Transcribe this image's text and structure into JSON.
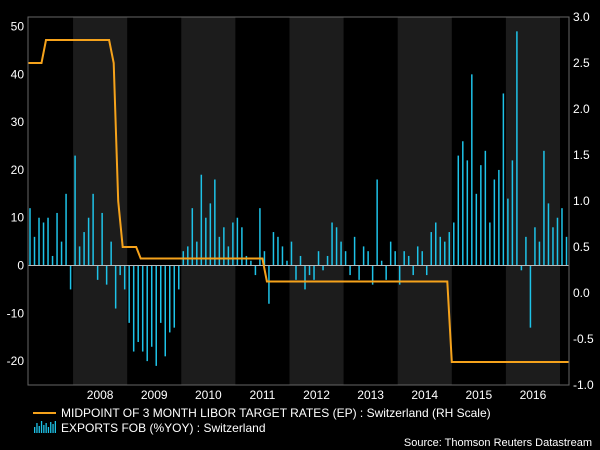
{
  "chart_data": {
    "type": "bar+line",
    "x_range": [
      "2007-03",
      "2017-03"
    ],
    "year_labels": [
      "2008",
      "2009",
      "2010",
      "2011",
      "2012",
      "2013",
      "2014",
      "2015",
      "2016"
    ],
    "left_axis": {
      "ylim": [
        -25,
        52
      ],
      "ticks": [
        "50",
        "40",
        "30",
        "20",
        "10",
        "0",
        "-10",
        "-20"
      ],
      "tick_values": [
        50,
        40,
        30,
        20,
        10,
        0,
        -10,
        -20
      ]
    },
    "right_axis": {
      "ylim": [
        -1.0,
        3.0
      ],
      "ticks": [
        "3.0",
        "2.5",
        "2.0",
        "1.5",
        "1.0",
        "0.5",
        "0.0",
        "-0.5",
        "-1.0"
      ],
      "tick_values": [
        3.0,
        2.5,
        2.0,
        1.5,
        1.0,
        0.5,
        0.0,
        -0.5,
        -1.0
      ]
    },
    "shaded_years": [
      "2008",
      "2010",
      "2012",
      "2014",
      "2016"
    ],
    "grid": false,
    "series": [
      {
        "name": "MIDPOINT OF 3 MONTH LIBOR TARGET RATES (EP) : Switzerland (RH Scale)",
        "kind": "line",
        "axis": "right",
        "color": "#f5a21b",
        "points": [
          [
            "2007-03",
            2.5
          ],
          [
            "2007-06",
            2.5
          ],
          [
            "2007-07",
            2.75
          ],
          [
            "2008-09",
            2.75
          ],
          [
            "2008-10",
            2.5
          ],
          [
            "2008-11",
            1.0
          ],
          [
            "2008-12",
            0.5
          ],
          [
            "2009-03",
            0.5
          ],
          [
            "2009-04",
            0.375
          ],
          [
            "2011-07",
            0.375
          ],
          [
            "2011-08",
            0.125
          ],
          [
            "2014-12",
            0.125
          ],
          [
            "2015-01",
            -0.75
          ],
          [
            "2017-03",
            -0.75
          ]
        ]
      },
      {
        "name": "EXPORTS FOB (%YOY) : Switzerland",
        "kind": "bar",
        "axis": "left",
        "color": "#1ec3e8",
        "points": [
          [
            "2007-03",
            12
          ],
          [
            "2007-04",
            6
          ],
          [
            "2007-05",
            10
          ],
          [
            "2007-06",
            9
          ],
          [
            "2007-07",
            10
          ],
          [
            "2007-08",
            2
          ],
          [
            "2007-09",
            11
          ],
          [
            "2007-10",
            5
          ],
          [
            "2007-11",
            15
          ],
          [
            "2007-12",
            -5
          ],
          [
            "2008-01",
            23
          ],
          [
            "2008-02",
            4
          ],
          [
            "2008-03",
            7
          ],
          [
            "2008-04",
            10
          ],
          [
            "2008-05",
            15
          ],
          [
            "2008-06",
            -3
          ],
          [
            "2008-07",
            11
          ],
          [
            "2008-08",
            -4
          ],
          [
            "2008-09",
            5
          ],
          [
            "2008-10",
            -9
          ],
          [
            "2008-11",
            -2
          ],
          [
            "2008-12",
            -5
          ],
          [
            "2009-01",
            -12
          ],
          [
            "2009-02",
            -18
          ],
          [
            "2009-03",
            -16
          ],
          [
            "2009-04",
            -18
          ],
          [
            "2009-05",
            -20
          ],
          [
            "2009-06",
            -17
          ],
          [
            "2009-07",
            -21
          ],
          [
            "2009-08",
            -12
          ],
          [
            "2009-09",
            -19
          ],
          [
            "2009-10",
            -14
          ],
          [
            "2009-11",
            -13
          ],
          [
            "2009-12",
            -5
          ],
          [
            "2010-01",
            3
          ],
          [
            "2010-02",
            4
          ],
          [
            "2010-03",
            12
          ],
          [
            "2010-04",
            5
          ],
          [
            "2010-05",
            19
          ],
          [
            "2010-06",
            10
          ],
          [
            "2010-07",
            13
          ],
          [
            "2010-08",
            18
          ],
          [
            "2010-09",
            6
          ],
          [
            "2010-10",
            8
          ],
          [
            "2010-11",
            4
          ],
          [
            "2010-12",
            9
          ],
          [
            "2011-01",
            10
          ],
          [
            "2011-02",
            8
          ],
          [
            "2011-03",
            2
          ],
          [
            "2011-04",
            1
          ],
          [
            "2011-05",
            -2
          ],
          [
            "2011-06",
            12
          ],
          [
            "2011-07",
            3
          ],
          [
            "2011-08",
            -8
          ],
          [
            "2011-09",
            7
          ],
          [
            "2011-10",
            6
          ],
          [
            "2011-11",
            4
          ],
          [
            "2011-12",
            1
          ],
          [
            "2012-01",
            5
          ],
          [
            "2012-02",
            -3
          ],
          [
            "2012-03",
            2
          ],
          [
            "2012-04",
            -5
          ],
          [
            "2012-05",
            -2
          ],
          [
            "2012-06",
            -3
          ],
          [
            "2012-07",
            3
          ],
          [
            "2012-08",
            -1
          ],
          [
            "2012-09",
            2
          ],
          [
            "2012-10",
            9
          ],
          [
            "2012-11",
            8
          ],
          [
            "2012-12",
            5
          ],
          [
            "2013-01",
            3
          ],
          [
            "2013-02",
            -2
          ],
          [
            "2013-03",
            6
          ],
          [
            "2013-04",
            -3
          ],
          [
            "2013-05",
            4
          ],
          [
            "2013-06",
            3
          ],
          [
            "2013-07",
            -4
          ],
          [
            "2013-08",
            18
          ],
          [
            "2013-09",
            1
          ],
          [
            "2013-10",
            -3
          ],
          [
            "2013-11",
            5
          ],
          [
            "2013-12",
            3
          ],
          [
            "2014-01",
            -4
          ],
          [
            "2014-02",
            3
          ],
          [
            "2014-03",
            2
          ],
          [
            "2014-04",
            -2
          ],
          [
            "2014-05",
            4
          ],
          [
            "2014-06",
            3
          ],
          [
            "2014-07",
            -2
          ],
          [
            "2014-08",
            7
          ],
          [
            "2014-09",
            9
          ],
          [
            "2014-10",
            6
          ],
          [
            "2014-11",
            5
          ],
          [
            "2014-12",
            7
          ],
          [
            "2015-01",
            9
          ],
          [
            "2015-02",
            23
          ],
          [
            "2015-03",
            26
          ],
          [
            "2015-04",
            22
          ],
          [
            "2015-05",
            40
          ],
          [
            "2015-06",
            15
          ],
          [
            "2015-07",
            21
          ],
          [
            "2015-08",
            24
          ],
          [
            "2015-09",
            9
          ],
          [
            "2015-10",
            18
          ],
          [
            "2015-11",
            20
          ],
          [
            "2015-12",
            36
          ],
          [
            "2016-01",
            14
          ],
          [
            "2016-02",
            22
          ],
          [
            "2016-03",
            49
          ],
          [
            "2016-04",
            -1
          ],
          [
            "2016-05",
            6
          ],
          [
            "2016-06",
            -13
          ],
          [
            "2016-07",
            8
          ],
          [
            "2016-08",
            5
          ],
          [
            "2016-09",
            24
          ],
          [
            "2016-10",
            13
          ],
          [
            "2016-11",
            8
          ],
          [
            "2016-12",
            10
          ],
          [
            "2017-01",
            12
          ],
          [
            "2017-02",
            6
          ]
        ]
      }
    ],
    "legend": {
      "position": "bottom-left"
    },
    "source": "Source: Thomson Reuters Datastream"
  }
}
